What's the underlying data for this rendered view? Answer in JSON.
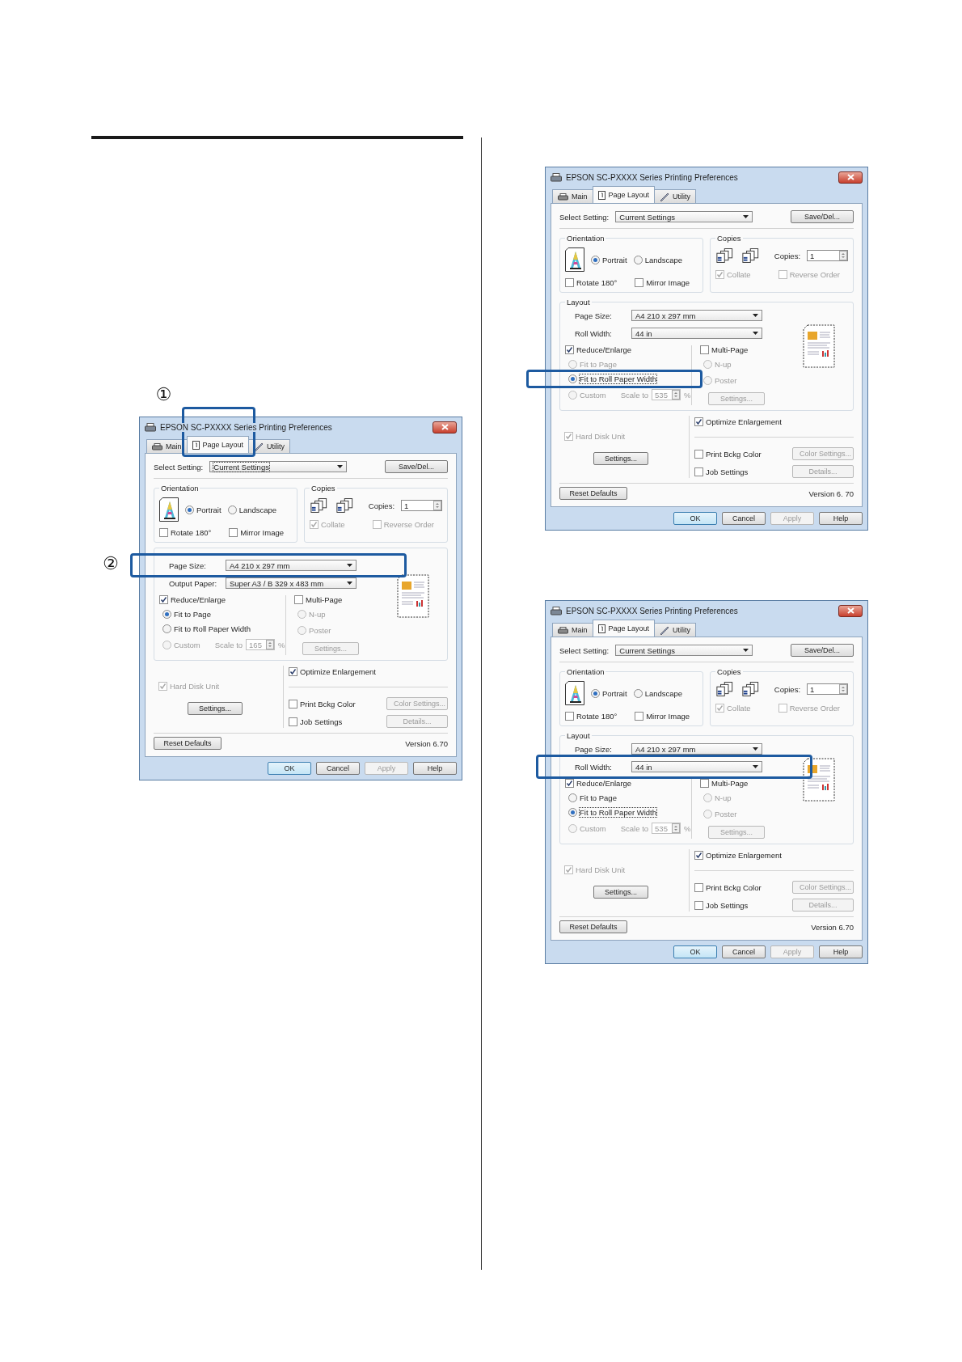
{
  "dialogs": [
    {
      "title": "EPSON SC-PXXXX Series Printing Preferences",
      "tabs": [
        {
          "label": "Main",
          "selected": false,
          "highlighted": false
        },
        {
          "label": "Page Layout",
          "selected": true,
          "highlighted": true,
          "callout": "①"
        },
        {
          "label": "Utility",
          "selected": false,
          "highlighted": false
        }
      ],
      "select_setting": {
        "label": "Select Setting:",
        "value": "Current Settings",
        "focused": true
      },
      "save_button": "Save/Del...",
      "orientation": {
        "label": "Orientation",
        "options": [
          {
            "label": "Portrait",
            "selected": true
          },
          {
            "label": "Landscape",
            "selected": false
          }
        ],
        "checkboxes": [
          {
            "label": "Rotate 180°",
            "checked": false
          },
          {
            "label": "Mirror Image",
            "checked": false
          }
        ]
      },
      "copies": {
        "label": "Copies",
        "field_label": "Copies:",
        "value": "1",
        "checkboxes": [
          {
            "label": "Collate",
            "checked": true,
            "disabled": true
          },
          {
            "label": "Reverse Order",
            "checked": false,
            "disabled": true
          }
        ]
      },
      "layout": {
        "fields": [
          {
            "label": "Page Size:",
            "value": "A4 210 x 297 mm",
            "highlighted": true,
            "callout": "②"
          },
          {
            "label": "Output Paper:",
            "value": "Super A3 / B 329 x 483 mm",
            "highlighted": false
          }
        ],
        "reduce": {
          "label": "Reduce/Enlarge",
          "checked": true
        },
        "fit_options": [
          {
            "label": "Fit to Page",
            "selected": true,
            "disabled": false,
            "focused": false,
            "highlighted": false
          },
          {
            "label": "Fit to Roll Paper Width",
            "selected": false,
            "disabled": false,
            "focused": false,
            "highlighted": false
          },
          {
            "label": "Custom",
            "selected": false,
            "disabled": true,
            "focused": false,
            "highlighted": false
          }
        ],
        "scale": {
          "label": "Scale to",
          "value": "165",
          "unit": "%"
        },
        "multi_page": {
          "label": "Multi-Page",
          "checked": false
        },
        "multi_options": [
          {
            "label": "N-up",
            "selected": false,
            "disabled": true
          },
          {
            "label": "Poster",
            "selected": false,
            "disabled": true
          }
        ],
        "multi_settings": {
          "label": "Settings...",
          "disabled": true
        }
      },
      "hard_disk": {
        "label": "Hard Disk Unit",
        "checked": true,
        "disabled": true
      },
      "settings_button": "Settings...",
      "optimize": {
        "label": "Optimize Enlargement",
        "checked": true
      },
      "print_bckg": {
        "label": "Print Bckg Color",
        "checked": false
      },
      "color_settings": {
        "label": "Color Settings...",
        "disabled": true
      },
      "job_settings": {
        "label": "Job Settings",
        "checked": false
      },
      "details": {
        "label": "Details...",
        "disabled": true
      },
      "reset_button": "Reset Defaults",
      "version": "Version 6.70",
      "footer_buttons": [
        {
          "label": "OK",
          "disabled": false,
          "default": true
        },
        {
          "label": "Cancel",
          "disabled": false,
          "default": false
        },
        {
          "label": "Apply",
          "disabled": true,
          "default": false
        },
        {
          "label": "Help",
          "disabled": false,
          "default": false
        }
      ]
    },
    {
      "title": "EPSON SC-PXXXX Series Printing Preferences",
      "tabs": [
        {
          "label": "Main",
          "selected": false,
          "highlighted": false
        },
        {
          "label": "Page Layout",
          "selected": true,
          "highlighted": false
        },
        {
          "label": "Utility",
          "selected": false,
          "highlighted": false
        }
      ],
      "select_setting": {
        "label": "Select Setting:",
        "value": "Current Settings",
        "focused": false
      },
      "save_button": "Save/Del...",
      "orientation": {
        "label": "Orientation",
        "options": [
          {
            "label": "Portrait",
            "selected": true
          },
          {
            "label": "Landscape",
            "selected": false
          }
        ],
        "checkboxes": [
          {
            "label": "Rotate 180°",
            "checked": false
          },
          {
            "label": "Mirror Image",
            "checked": false
          }
        ]
      },
      "copies": {
        "label": "Copies",
        "field_label": "Copies:",
        "value": "1",
        "checkboxes": [
          {
            "label": "Collate",
            "checked": true,
            "disabled": true
          },
          {
            "label": "Reverse Order",
            "checked": false,
            "disabled": true
          }
        ]
      },
      "layout": {
        "label": "Layout",
        "fields": [
          {
            "label": "Page Size:",
            "value": "A4 210 x 297 mm",
            "highlighted": false
          },
          {
            "label": "Roll Width:",
            "value": "44 in",
            "highlighted": false
          }
        ],
        "reduce": {
          "label": "Reduce/Enlarge",
          "checked": true
        },
        "fit_options": [
          {
            "label": "Fit to Page",
            "selected": false,
            "disabled": true,
            "focused": false,
            "highlighted": false
          },
          {
            "label": "Fit to Roll Paper Width",
            "selected": true,
            "disabled": false,
            "focused": true,
            "highlighted": true
          },
          {
            "label": "Custom",
            "selected": false,
            "disabled": true,
            "focused": false,
            "highlighted": false
          }
        ],
        "scale": {
          "label": "Scale to",
          "value": "535",
          "unit": "%"
        },
        "multi_page": {
          "label": "Multi-Page",
          "checked": false
        },
        "multi_options": [
          {
            "label": "N-up",
            "selected": false,
            "disabled": true
          },
          {
            "label": "Poster",
            "selected": false,
            "disabled": true
          }
        ],
        "multi_settings": {
          "label": "Settings...",
          "disabled": true
        }
      },
      "hard_disk": {
        "label": "Hard Disk Unit",
        "checked": true,
        "disabled": true
      },
      "settings_button": "Settings...",
      "optimize": {
        "label": "Optimize Enlargement",
        "checked": true
      },
      "print_bckg": {
        "label": "Print Bckg Color",
        "checked": false
      },
      "color_settings": {
        "label": "Color Settings...",
        "disabled": true
      },
      "job_settings": {
        "label": "Job Settings",
        "checked": false
      },
      "details": {
        "label": "Details...",
        "disabled": true
      },
      "reset_button": "Reset Defaults",
      "version": "Version 6. 70",
      "footer_buttons": [
        {
          "label": "OK",
          "disabled": false,
          "default": true
        },
        {
          "label": "Cancel",
          "disabled": false,
          "default": false
        },
        {
          "label": "Apply",
          "disabled": true,
          "default": false
        },
        {
          "label": "Help",
          "disabled": false,
          "default": false
        }
      ]
    },
    {
      "title": "EPSON SC-PXXXX Series Printing Preferences",
      "tabs": [
        {
          "label": "Main",
          "selected": false,
          "highlighted": false
        },
        {
          "label": "Page Layout",
          "selected": true,
          "highlighted": false
        },
        {
          "label": "Utility",
          "selected": false,
          "highlighted": false
        }
      ],
      "select_setting": {
        "label": "Select Setting:",
        "value": "Current Settings",
        "focused": false
      },
      "save_button": "Save/Del...",
      "orientation": {
        "label": "Orientation",
        "options": [
          {
            "label": "Portrait",
            "selected": true
          },
          {
            "label": "Landscape",
            "selected": false
          }
        ],
        "checkboxes": [
          {
            "label": "Rotate 180°",
            "checked": false
          },
          {
            "label": "Mirror Image",
            "checked": false
          }
        ]
      },
      "copies": {
        "label": "Copies",
        "field_label": "Copies:",
        "value": "1",
        "checkboxes": [
          {
            "label": "Collate",
            "checked": true,
            "disabled": true
          },
          {
            "label": "Reverse Order",
            "checked": false,
            "disabled": true
          }
        ]
      },
      "layout": {
        "label": "Layout",
        "fields": [
          {
            "label": "Page Size:",
            "value": "A4 210 x 297 mm",
            "highlighted": false
          },
          {
            "label": "Roll Width:",
            "value": "44 in",
            "highlighted": true
          }
        ],
        "reduce": {
          "label": "Reduce/Enlarge",
          "checked": true
        },
        "fit_options": [
          {
            "label": "Fit to Page",
            "selected": false,
            "disabled": false,
            "focused": false,
            "highlighted": false
          },
          {
            "label": "Fit to Roll Paper Width",
            "selected": true,
            "disabled": false,
            "focused": true,
            "highlighted": false
          },
          {
            "label": "Custom",
            "selected": false,
            "disabled": true,
            "focused": false,
            "highlighted": false
          }
        ],
        "scale": {
          "label": "Scale to",
          "value": "535",
          "unit": "%"
        },
        "multi_page": {
          "label": "Multi-Page",
          "checked": false
        },
        "multi_options": [
          {
            "label": "N-up",
            "selected": false,
            "disabled": true
          },
          {
            "label": "Poster",
            "selected": false,
            "disabled": true
          }
        ],
        "multi_settings": {
          "label": "Settings...",
          "disabled": true
        }
      },
      "hard_disk": {
        "label": "Hard Disk Unit",
        "checked": true,
        "disabled": true
      },
      "settings_button": "Settings...",
      "optimize": {
        "label": "Optimize Enlargement",
        "checked": true
      },
      "print_bckg": {
        "label": "Print Bckg Color",
        "checked": false
      },
      "color_settings": {
        "label": "Color Settings...",
        "disabled": true
      },
      "job_settings": {
        "label": "Job Settings",
        "checked": false
      },
      "details": {
        "label": "Details...",
        "disabled": true
      },
      "reset_button": "Reset Defaults",
      "version": "Version 6.70",
      "footer_buttons": [
        {
          "label": "OK",
          "disabled": false,
          "default": true
        },
        {
          "label": "Cancel",
          "disabled": false,
          "default": false
        },
        {
          "label": "Apply",
          "disabled": true,
          "default": false
        },
        {
          "label": "Help",
          "disabled": false,
          "default": false
        }
      ]
    }
  ]
}
